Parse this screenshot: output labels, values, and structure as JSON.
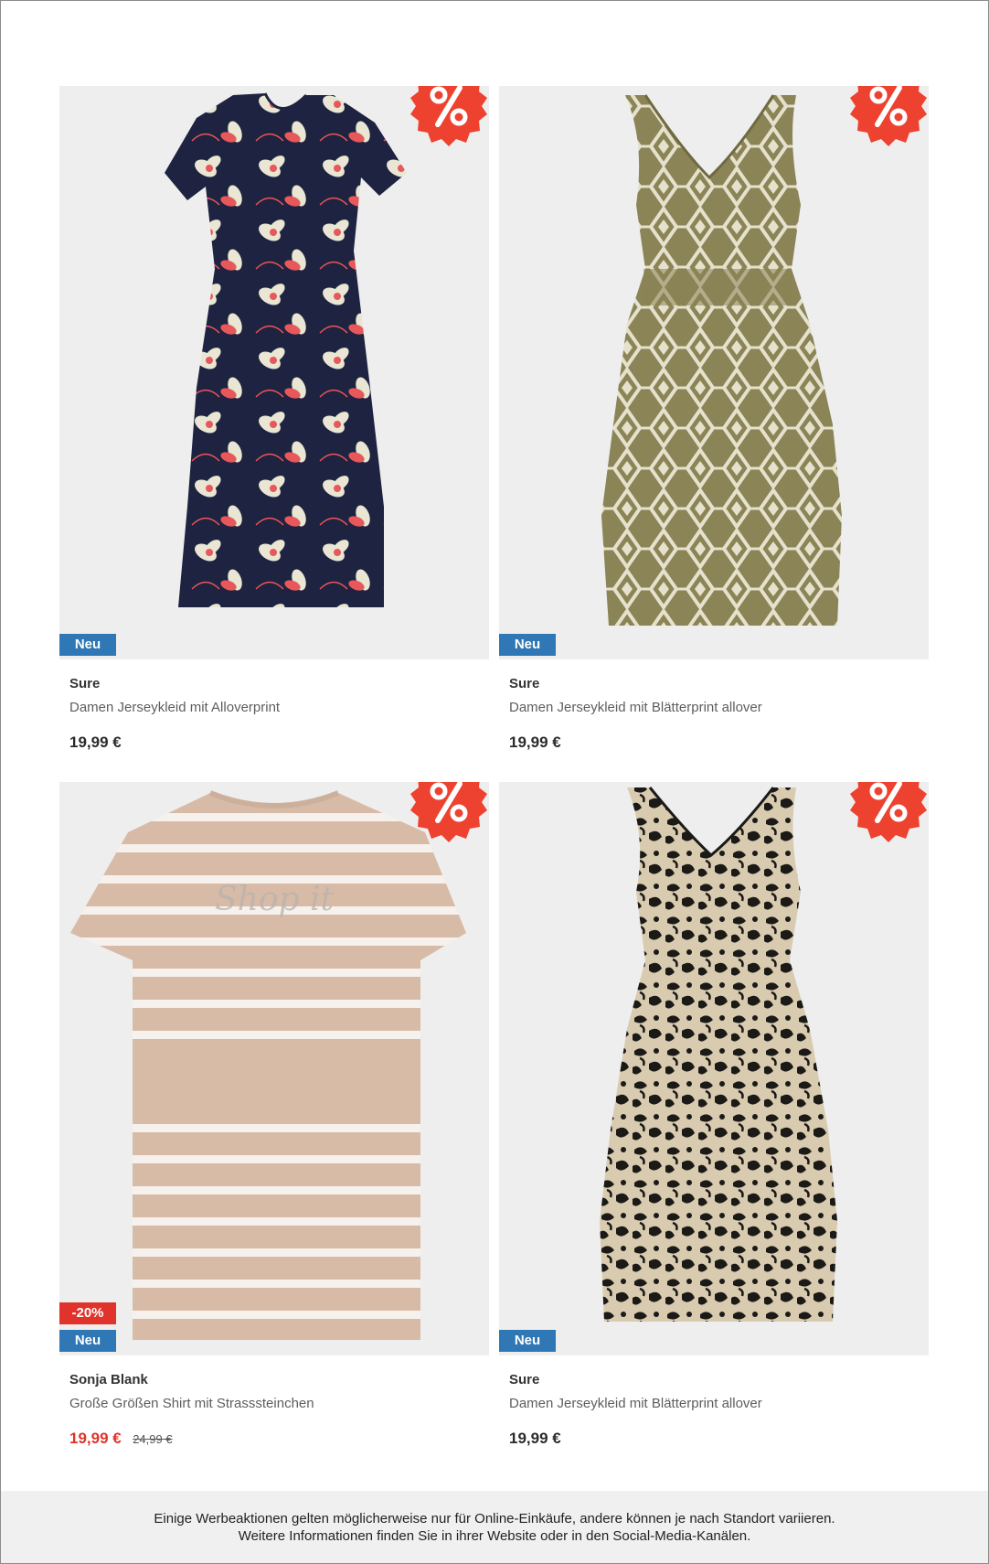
{
  "products": [
    {
      "brand": "Sure",
      "name": "Damen Jerseykleid mit Alloverprint",
      "price": "19,99 €",
      "badge_new": "Neu",
      "promo_icon": "percent-icon"
    },
    {
      "brand": "Sure",
      "name": "Damen Jerseykleid mit Blätterprint allover",
      "price": "19,99 €",
      "badge_new": "Neu",
      "promo_icon": "percent-icon"
    },
    {
      "brand": "Sonja Blank",
      "name": "Große Größen Shirt mit Strasssteinchen",
      "price": "19,99 €",
      "old_price": "24,99 €",
      "badge_discount": "-20%",
      "badge_new": "Neu",
      "promo_icon": "percent-icon"
    },
    {
      "brand": "Sure",
      "name": "Damen Jerseykleid mit Blätterprint allover",
      "price": "19,99 €",
      "badge_new": "Neu",
      "promo_icon": "percent-icon"
    }
  ],
  "footer": {
    "line1": "Einige Werbeaktionen gelten möglicherweise nur für Online-Einkäufe, andere können je nach Standort variieren.",
    "line2": "Weitere Informationen finden Sie in ihrer Website oder in den Social-Media-Kanälen."
  },
  "colors": {
    "new_badge": "#2f77b5",
    "discount_badge": "#e0332b",
    "promo_badge": "#ee4230",
    "sale_price": "#e0332b"
  }
}
